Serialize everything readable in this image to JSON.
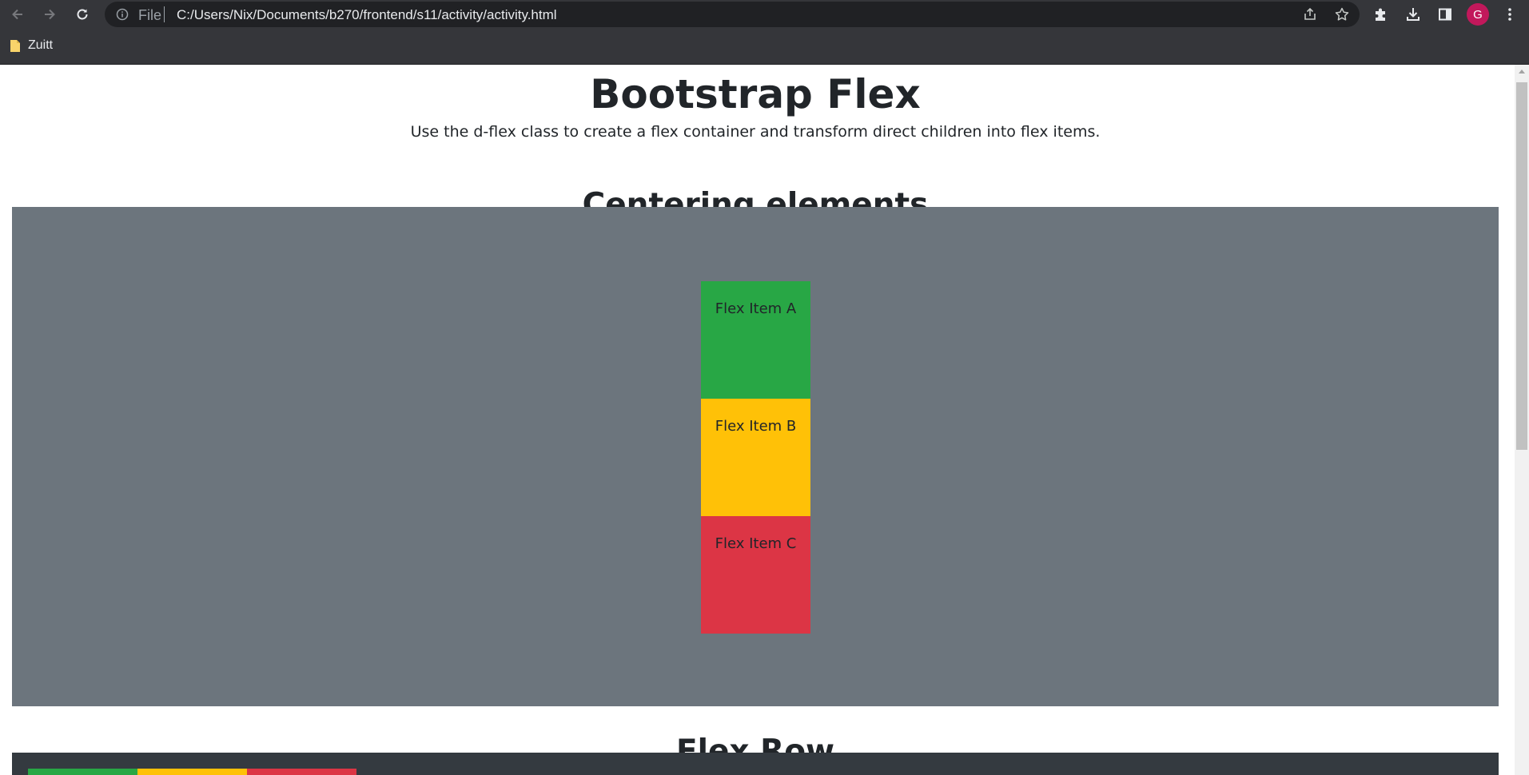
{
  "browser": {
    "scheme_label": "File",
    "url": "C:/Users/Nix/Documents/b270/frontend/s11/activity/activity.html",
    "profile_initial": "G",
    "bookmarks": [
      {
        "label": "Zuitt"
      }
    ]
  },
  "page": {
    "title": "Bootstrap Flex",
    "lead": "Use the d-flex class to create a flex container and transform direct children into flex items.",
    "sections": [
      {
        "title": "Centering elements",
        "items": [
          {
            "label": "Flex Item A",
            "color": "#28a745"
          },
          {
            "label": "Flex Item B",
            "color": "#ffc107"
          },
          {
            "label": "Flex Item C",
            "color": "#dc3545"
          }
        ],
        "background": "#6c757d"
      },
      {
        "title": "Flex Row",
        "items": [
          {
            "color": "#28a745"
          },
          {
            "color": "#ffc107"
          },
          {
            "color": "#dc3545"
          }
        ],
        "background": "#343a40"
      }
    ]
  }
}
